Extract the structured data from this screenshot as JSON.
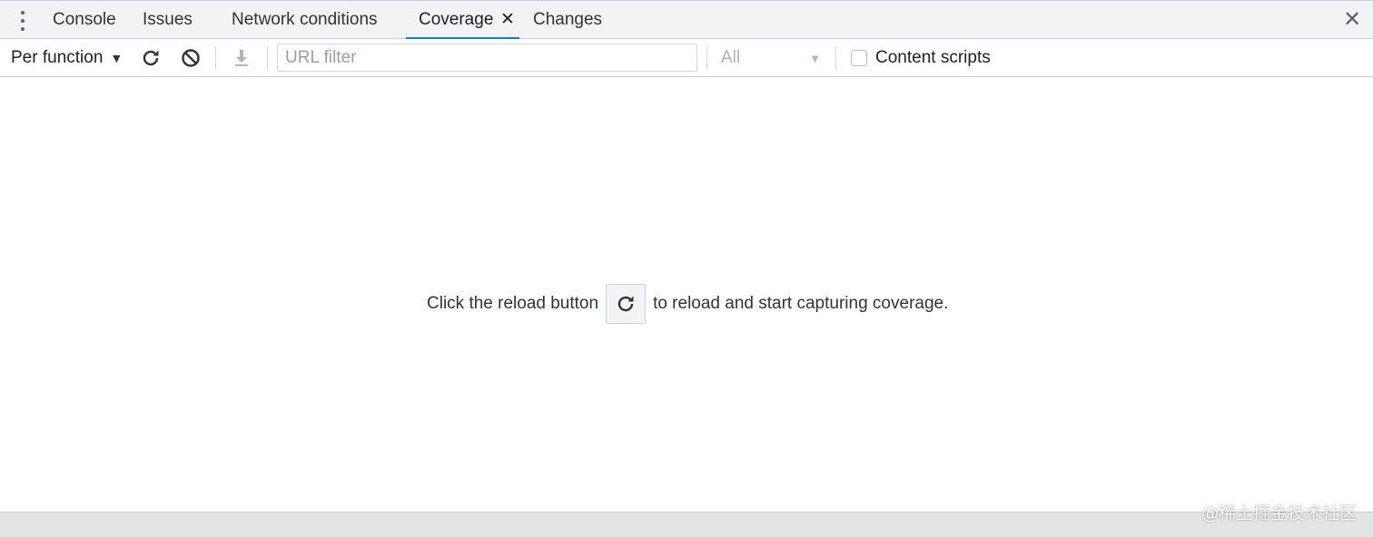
{
  "tabs": {
    "items": [
      {
        "label": "Console"
      },
      {
        "label": "Issues"
      },
      {
        "label": "Network conditions"
      },
      {
        "label": "Coverage"
      },
      {
        "label": "Changes"
      }
    ],
    "active": "Coverage",
    "close_glyph": "✕",
    "drawer_close_glyph": "✕"
  },
  "toolbar": {
    "mode_label": "Per function",
    "mode_arrow": "▼",
    "url_filter_placeholder": "URL filter",
    "type_filter_value": "All",
    "type_filter_caret": "▼",
    "content_scripts_label": "Content scripts",
    "icons": [
      "reload-icon",
      "clear-icon",
      "export-icon"
    ]
  },
  "main": {
    "message_before": "Click the reload button",
    "message_after": "to reload and start capturing coverage."
  },
  "watermark": "@稀土掘金技术社区",
  "colors": {
    "accent": "#1a73e8",
    "tabbar_bg": "#f1f3f4",
    "bottom_bar_bg": "#e3e4e6"
  }
}
